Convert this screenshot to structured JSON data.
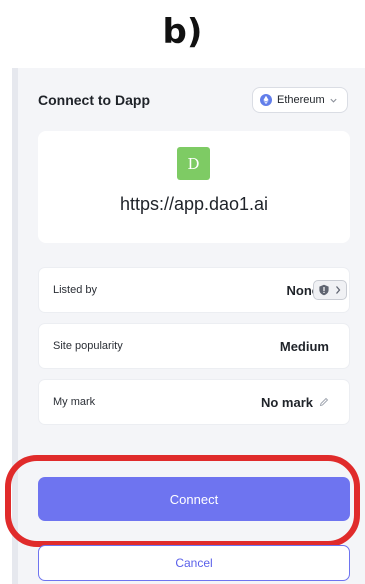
{
  "figure_label": "b)",
  "header": {
    "title": "Connect to Dapp"
  },
  "network": {
    "selected": "Ethereum",
    "accent": "#627eea"
  },
  "site": {
    "logo_letter": "D",
    "logo_color": "#7ecb64",
    "url": "https://app.dao1.ai"
  },
  "info_rows": [
    {
      "label": "Listed by",
      "value": "None",
      "icon": "shield-icon"
    },
    {
      "label": "Site popularity",
      "value": "Medium"
    },
    {
      "label": "My mark",
      "value": "No mark",
      "icon": "pencil-icon"
    }
  ],
  "actions": {
    "connect_label": "Connect",
    "cancel_label": "Cancel"
  },
  "colors": {
    "primary": "#6e74f0",
    "highlight": "#e02b2b"
  }
}
